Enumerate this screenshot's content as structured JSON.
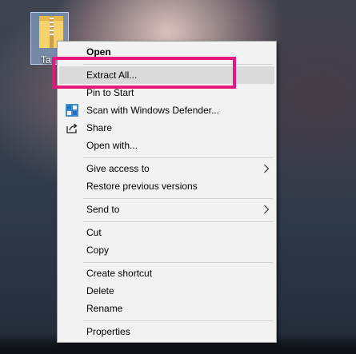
{
  "desktop": {
    "icon_label": "Ta"
  },
  "context_menu": {
    "items": [
      {
        "label": "Open",
        "icon": null
      },
      {
        "label": "Extract All...",
        "icon": null
      },
      {
        "label": "Pin to Start",
        "icon": null
      },
      {
        "label": "Scan with Windows Defender...",
        "icon": "windows-defender-icon"
      },
      {
        "label": "Share",
        "icon": "share-icon"
      },
      {
        "label": "Open with...",
        "icon": null
      },
      {
        "label": "Give access to",
        "submenu": true
      },
      {
        "label": "Restore previous versions"
      },
      {
        "label": "Send to",
        "submenu": true
      },
      {
        "label": "Cut"
      },
      {
        "label": "Copy"
      },
      {
        "label": "Create shortcut"
      },
      {
        "label": "Delete"
      },
      {
        "label": "Rename"
      },
      {
        "label": "Properties"
      }
    ]
  },
  "colors": {
    "highlight_border": "#e8177c",
    "menu_background": "#f2f2f2",
    "hover_background": "#dadada",
    "defender_icon": "#1e73c8"
  }
}
